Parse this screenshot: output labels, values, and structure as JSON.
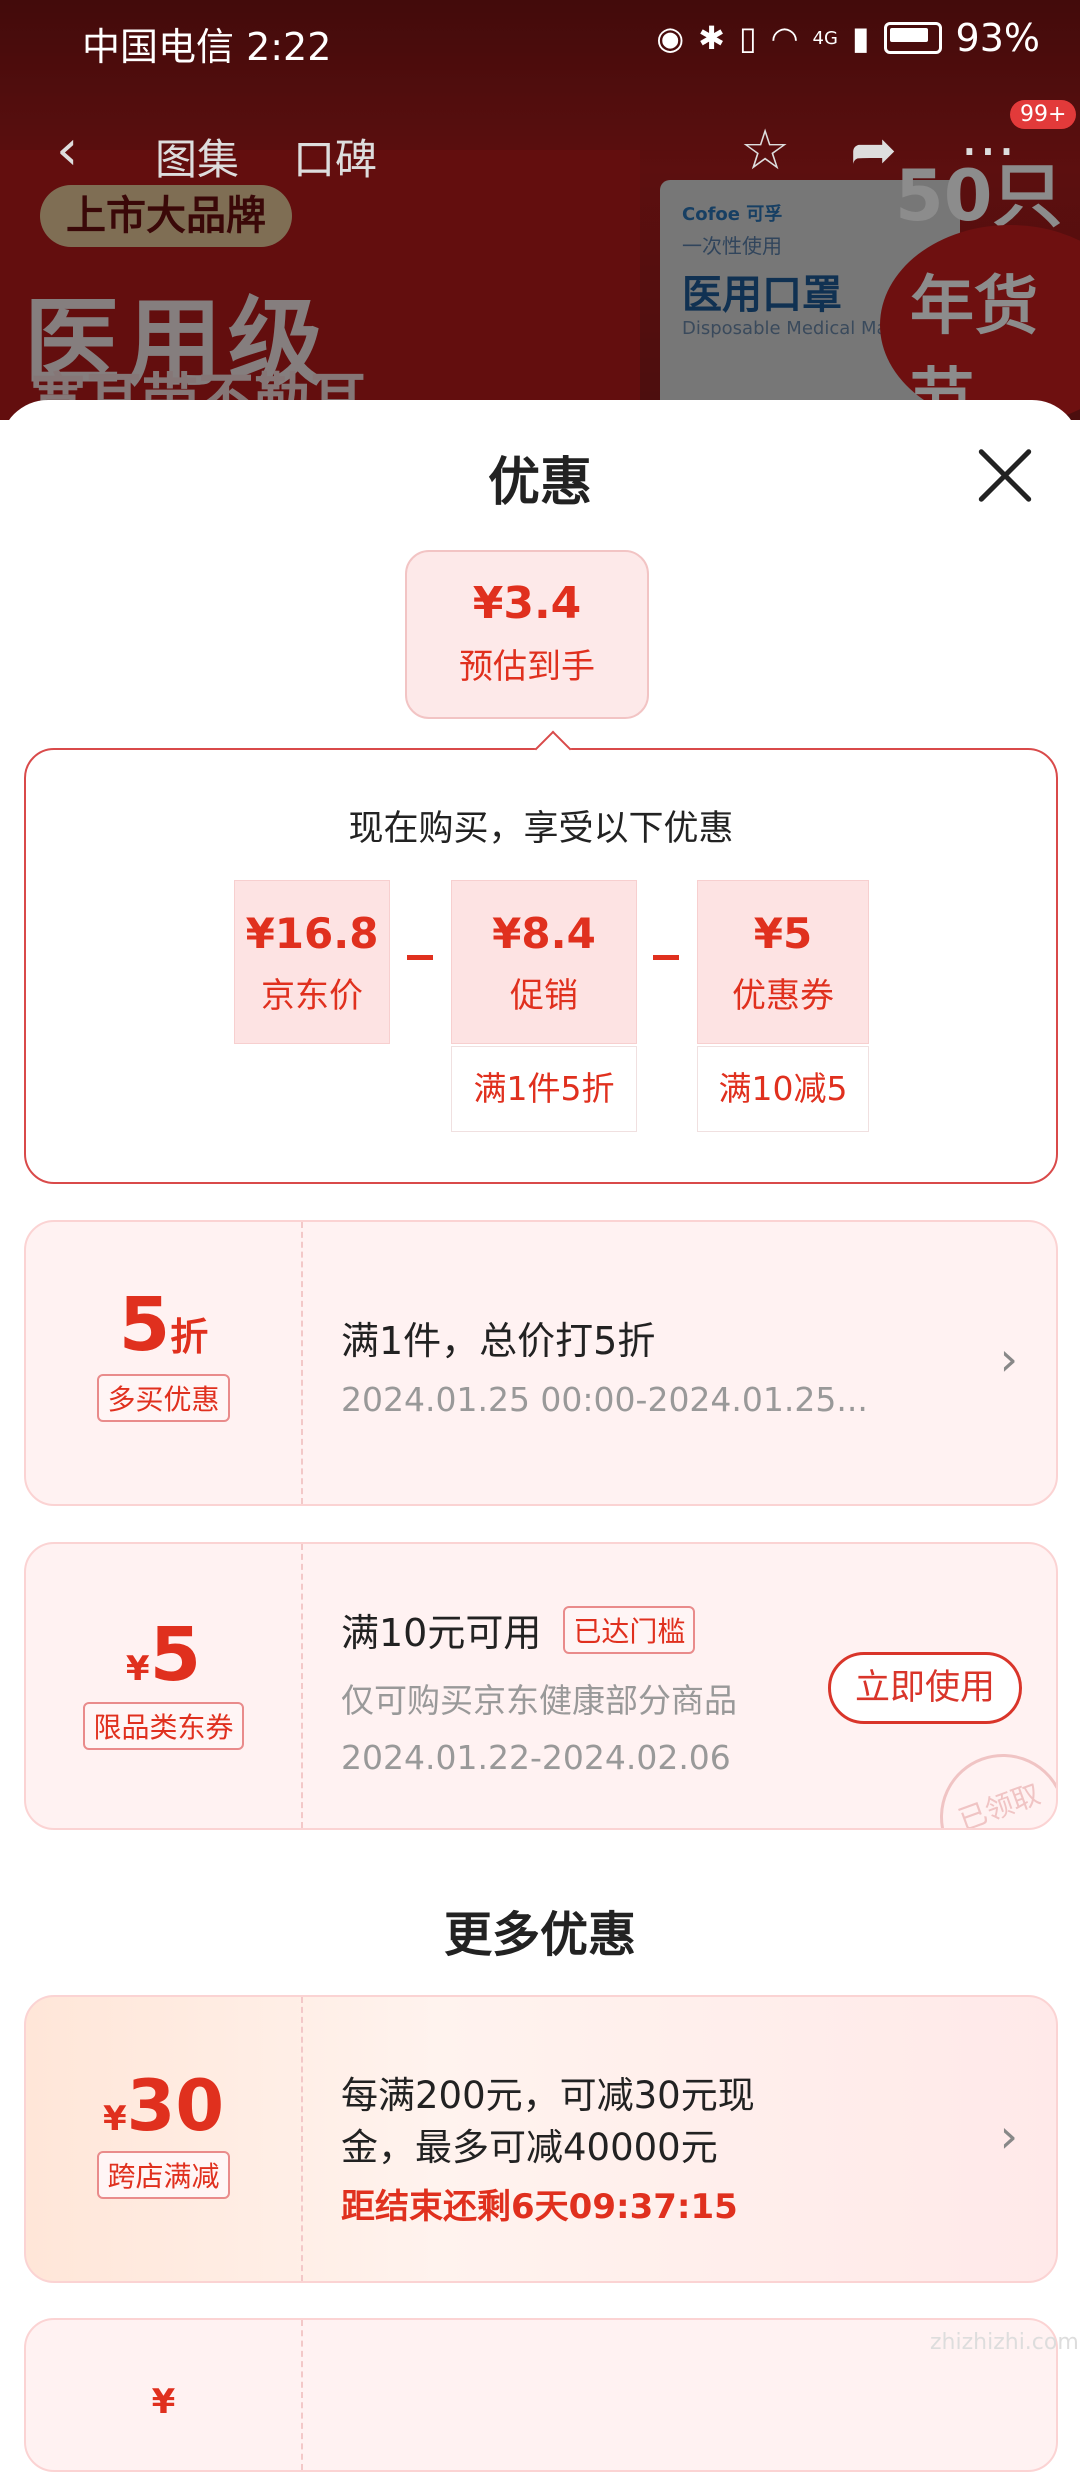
{
  "status_bar": {
    "carrier_time": "中国电信 2:22",
    "battery": "93%",
    "network": "4G"
  },
  "nav": {
    "tabs": [
      "图集",
      "口碑"
    ],
    "badge": "99+"
  },
  "hero": {
    "pill": "上市大品牌",
    "headline": "医用级",
    "subline": "宽耳带不勒耳",
    "box_logo": "Cofoe 可孚",
    "box_line1": "一次性使用",
    "box_title": "医用口罩",
    "box_line2": "Disposable Medical Mask",
    "count": "50只",
    "festival": "年货节"
  },
  "sheet": {
    "title": "优惠"
  },
  "estimate": {
    "amount": "¥3.4",
    "label": "预估到手"
  },
  "detail": {
    "heading": "现在购买，享受以下优惠",
    "items": [
      {
        "amount": "¥16.8",
        "label": "京东价",
        "note": ""
      },
      {
        "amount": "¥8.4",
        "label": "促销",
        "note": "满1件5折"
      },
      {
        "amount": "¥5",
        "label": "优惠券",
        "note": "满10减5"
      }
    ]
  },
  "promo1": {
    "value": "5",
    "unit": "折",
    "tag": "多买优惠",
    "title": "满1件，总价打5折",
    "period": "2024.01.25 00:00-2024.01.25..."
  },
  "promo2": {
    "currency": "¥",
    "value": "5",
    "tag": "限品类东券",
    "title": "满10元可用",
    "badge": "已达门槛",
    "desc": "仅可购买京东健康部分商品",
    "period": "2024.01.22-2024.02.06",
    "button": "立即使用",
    "stamp": "已领取"
  },
  "more": {
    "title": "更多优惠"
  },
  "promo3": {
    "currency": "¥",
    "value": "30",
    "tag": "跨店满减",
    "line1": "每满200元，可减30元现",
    "line2": "金，最多可减40000元",
    "countdown": "距结束还剩6天09:37:15"
  },
  "promo4": {
    "currency": "¥"
  },
  "watermark": "zhizhizhi.com",
  "colors": {
    "accent": "#e0301e",
    "card_bg": "#fff2f2"
  }
}
